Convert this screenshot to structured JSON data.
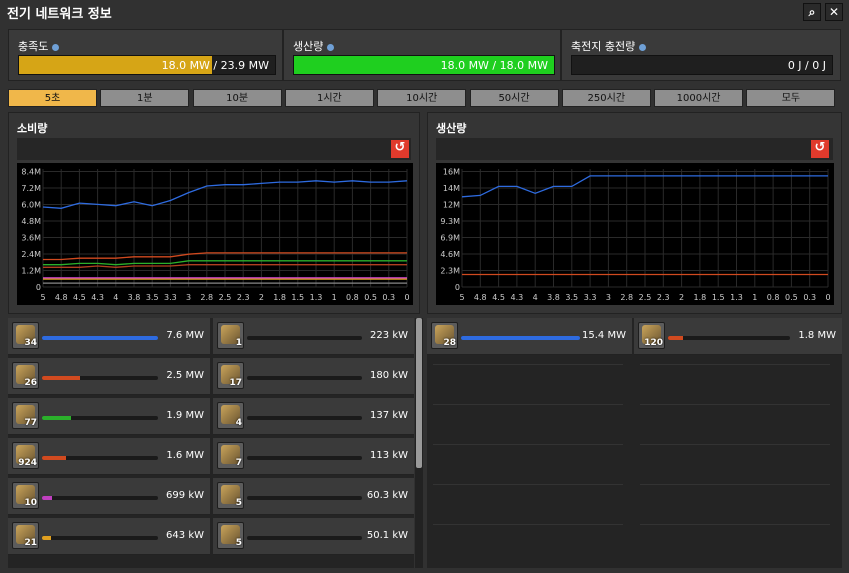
{
  "window": {
    "title": "전기 네트워크 정보",
    "search_icon": "search-icon",
    "close_icon": "close-icon"
  },
  "satisfaction": {
    "label": "충족도",
    "value": "18.0 MW / 23.9 MW",
    "fill": 0.753,
    "color": "#d6a516"
  },
  "production": {
    "label": "생산량",
    "value": "18.0 MW / 18.0 MW",
    "fill": 1.0,
    "color": "#1fcf1f"
  },
  "accumulator": {
    "label": "축전지 충전량",
    "value": "0 J / 0 J",
    "fill": 0,
    "color": "#888888"
  },
  "time_ranges": [
    "5초",
    "1분",
    "10분",
    "1시간",
    "10시간",
    "50시간",
    "250시간",
    "1000시간",
    "모두"
  ],
  "selected_range": 0,
  "consumption": {
    "title": "소비량"
  },
  "generation": {
    "title": "생산량"
  },
  "chart_data": [
    {
      "type": "line",
      "title": "소비량",
      "ylim": [
        0,
        9
      ],
      "yticks": [
        "0",
        "1.2M",
        "2.4M",
        "3.6M",
        "4.8M",
        "6.0M",
        "7.2M",
        "8.4M"
      ],
      "xticks": [
        "5",
        "4.8",
        "4.5",
        "4.3",
        "4",
        "3.8",
        "3.5",
        "3.3",
        "3",
        "2.8",
        "2.5",
        "2.3",
        "2",
        "1.8",
        "1.5",
        "1.3",
        "1",
        "0.8",
        "0.5",
        "0.3",
        "0"
      ],
      "series": [
        {
          "color": "#2e6be0",
          "values": [
            6.1,
            6.0,
            6.4,
            6.3,
            6.2,
            6.5,
            6.2,
            6.6,
            7.2,
            7.7,
            7.8,
            7.8,
            7.9,
            8.0,
            8.0,
            8.1,
            8.0,
            8.1,
            8.0,
            8.0,
            8.1
          ]
        },
        {
          "color": "#d14a1f",
          "values": [
            2.1,
            2.1,
            2.2,
            2.2,
            2.2,
            2.3,
            2.3,
            2.3,
            2.5,
            2.6,
            2.6,
            2.6,
            2.6,
            2.6,
            2.6,
            2.6,
            2.6,
            2.6,
            2.6,
            2.6,
            2.6
          ]
        },
        {
          "color": "#2bb02b",
          "values": [
            1.7,
            1.7,
            1.8,
            1.8,
            1.7,
            1.8,
            1.8,
            1.8,
            2.0,
            2.0,
            2.0,
            2.0,
            2.0,
            2.0,
            2.0,
            2.0,
            2.0,
            2.0,
            2.0,
            2.0,
            2.0
          ]
        },
        {
          "color": "#b04020",
          "values": [
            1.5,
            1.5,
            1.5,
            1.6,
            1.5,
            1.6,
            1.6,
            1.6,
            1.7,
            1.7,
            1.7,
            1.7,
            1.7,
            1.7,
            1.7,
            1.7,
            1.7,
            1.7,
            1.7,
            1.7,
            1.7
          ]
        },
        {
          "color": "#c040c0",
          "values": [
            0.7,
            0.7,
            0.7,
            0.7,
            0.7,
            0.7,
            0.7,
            0.7,
            0.7,
            0.7,
            0.7,
            0.7,
            0.7,
            0.7,
            0.7,
            0.7,
            0.7,
            0.7,
            0.7,
            0.7,
            0.7
          ]
        },
        {
          "color": "#e0a020",
          "values": [
            0.6,
            0.6,
            0.6,
            0.6,
            0.6,
            0.6,
            0.6,
            0.6,
            0.6,
            0.6,
            0.6,
            0.6,
            0.6,
            0.6,
            0.6,
            0.6,
            0.6,
            0.6,
            0.6,
            0.6,
            0.6
          ]
        },
        {
          "color": "#888888",
          "values": [
            0.3,
            0.3,
            0.3,
            0.3,
            0.3,
            0.3,
            0.3,
            0.3,
            0.3,
            0.3,
            0.3,
            0.3,
            0.3,
            0.3,
            0.3,
            0.3,
            0.3,
            0.3,
            0.3,
            0.3,
            0.3
          ]
        }
      ]
    },
    {
      "type": "line",
      "title": "생산량",
      "ylim": [
        0,
        17
      ],
      "yticks": [
        "0",
        "2.3M",
        "4.6M",
        "6.9M",
        "9.3M",
        "12M",
        "14M",
        "16M"
      ],
      "xticks": [
        "5",
        "4.8",
        "4.5",
        "4.3",
        "4",
        "3.8",
        "3.5",
        "3.3",
        "3",
        "2.8",
        "2.5",
        "2.3",
        "2",
        "1.8",
        "1.5",
        "1.3",
        "1",
        "0.8",
        "0.5",
        "0.3",
        "0"
      ],
      "series": [
        {
          "color": "#2e6be0",
          "values": [
            13.0,
            13.2,
            14.5,
            14.5,
            13.5,
            14.5,
            14.5,
            16.0,
            16.0,
            16.0,
            16.0,
            16.0,
            16.0,
            16.0,
            16.0,
            16.0,
            16.0,
            16.0,
            16.0,
            16.0,
            16.0
          ]
        },
        {
          "color": "#d14a1f",
          "values": [
            1.8,
            1.8,
            1.8,
            1.8,
            1.8,
            1.8,
            1.8,
            1.8,
            1.8,
            1.8,
            1.8,
            1.8,
            1.8,
            1.8,
            1.8,
            1.8,
            1.8,
            1.8,
            1.8,
            1.8,
            1.8
          ]
        }
      ]
    }
  ],
  "consumers": [
    {
      "count": "34",
      "value": "7.6 MW",
      "fill": 1.0,
      "color": "#2e6be0",
      "icon": "assembler-icon"
    },
    {
      "count": "1",
      "value": "223 kW",
      "fill": 0,
      "color": "#888888",
      "icon": "pump-icon"
    },
    {
      "count": "26",
      "value": "2.5 MW",
      "fill": 0.33,
      "color": "#d14a1f",
      "icon": "mining-drill-icon"
    },
    {
      "count": "17",
      "value": "180 kW",
      "fill": 0,
      "color": "#888888",
      "icon": "inserter-icon"
    },
    {
      "count": "77",
      "value": "1.9 MW",
      "fill": 0.25,
      "color": "#2bb02b",
      "icon": "lab-icon"
    },
    {
      "count": "4",
      "value": "137 kW",
      "fill": 0,
      "color": "#888888",
      "icon": "roboport-icon"
    },
    {
      "count": "924",
      "value": "1.6 MW",
      "fill": 0.21,
      "color": "#d14a1f",
      "icon": "inserter-icon"
    },
    {
      "count": "7",
      "value": "113 kW",
      "fill": 0,
      "color": "#888888",
      "icon": "beacon-icon"
    },
    {
      "count": "10",
      "value": "699 kW",
      "fill": 0.09,
      "color": "#c040c0",
      "icon": "refinery-icon"
    },
    {
      "count": "5",
      "value": "60.3 kW",
      "fill": 0,
      "color": "#888888",
      "icon": "lamp-icon"
    },
    {
      "count": "21",
      "value": "643 kW",
      "fill": 0.08,
      "color": "#e0a020",
      "icon": "chemical-plant-icon"
    },
    {
      "count": "5",
      "value": "50.1 kW",
      "fill": 0,
      "color": "#888888",
      "icon": "radar-icon"
    }
  ],
  "producers": [
    {
      "count": "28",
      "value": "15.4 MW",
      "fill": 1.0,
      "color": "#2e6be0",
      "icon": "steam-engine-icon"
    },
    {
      "count": "120",
      "value": "1.8 MW",
      "fill": 0.12,
      "color": "#d14a1f",
      "icon": "solar-panel-icon"
    }
  ]
}
